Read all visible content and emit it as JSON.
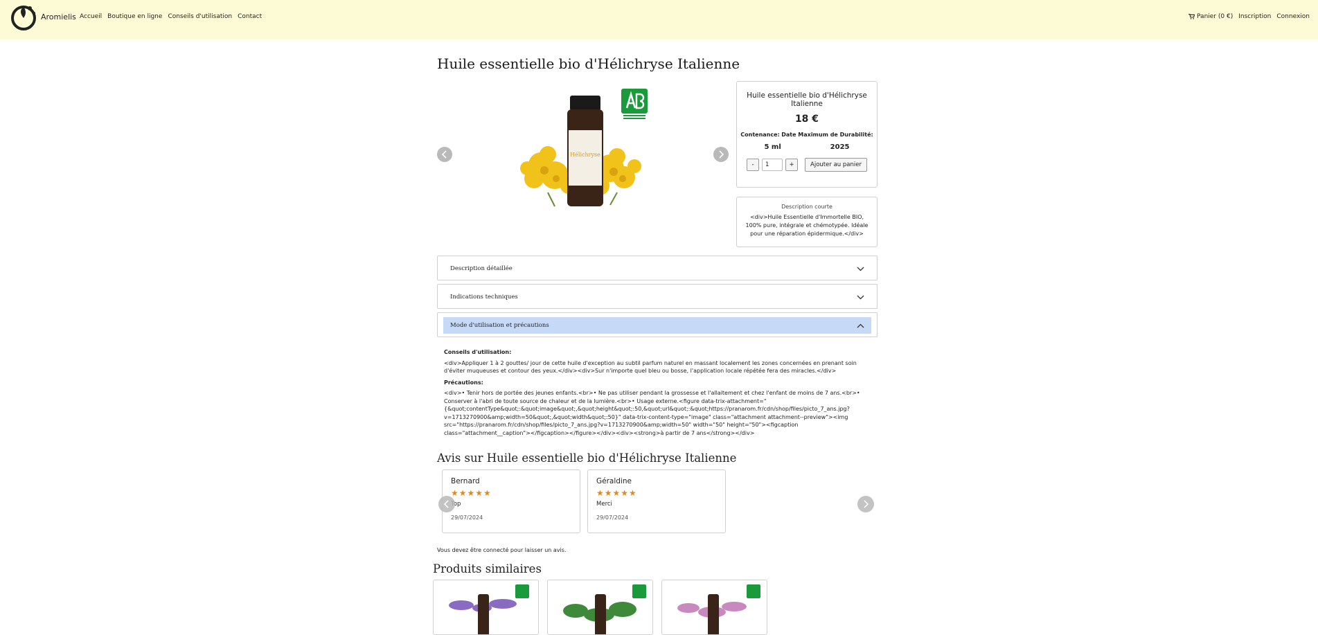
{
  "header": {
    "brand": "Aromielis",
    "nav": [
      "Accueil",
      "Boutique en ligne",
      "Conseils d'utilisation",
      "Contact"
    ],
    "cart": "Panier (0 €)",
    "register": "Inscription",
    "login": "Connexion"
  },
  "product": {
    "title": "Huile essentielle bio d'Hélichryse Italienne",
    "name": "Huile essentielle bio d'Hélichryse Italienne",
    "price": "18 €",
    "contenance_label": "Contenance:",
    "ddm_label": "Date Maximum de Durabilité:",
    "contenance_value": "5 ml",
    "ddm_value": "2025",
    "qty_minus": "-",
    "qty_value": "1",
    "qty_plus": "+",
    "add_to_cart": "Ajouter au panier",
    "short_desc_title": "Description courte",
    "short_desc_text": "<div>Huile Essentielle d'Immortelle BIO, 100% pure, intégrale et chémotypée. Idéale pour une réparation épidermique.</div>",
    "bottle_label_text": "Hélichryse"
  },
  "accordions": [
    {
      "label": "Description détaillée",
      "open": false
    },
    {
      "label": "Indications techniques",
      "open": false
    },
    {
      "label": "Mode d'utilisation et précautions",
      "open": true
    }
  ],
  "usage": {
    "conseils_title": "Conseils d'utilisation:",
    "conseils_text": "<div>Appliquer 1 à 2 gouttes/ jour de cette huile d'exception au subtil parfum naturel en massant localement les zones concernées en prenant soin d'éviter muqueuses et contour des yeux.</div><div>Sur n'importe quel bleu ou bosse, l'application locale répétée fera des miracles.</div>",
    "precautions_title": "Précautions:",
    "precautions_text": "<div>• Tenir hors de portée des jeunes enfants.<br>• Ne pas utiliser pendant la grossesse et l'allaitement et chez l'enfant de moins de 7 ans.<br>• Conserver à l'abri de toute source de chaleur et de la lumière.<br>• Usage externe.<figure data-trix-attachment=\"{&quot;contentType&quot;:&quot;image&quot;,&quot;height&quot;:50,&quot;url&quot;:&quot;https://pranarom.fr/cdn/shop/files/picto_7_ans.jpg?v=1713270900&amp;width=50&quot;,&quot;width&quot;:50}\" data-trix-content-type=\"image\" class=\"attachment attachment--preview\"><img src=\"https://pranarom.fr/cdn/shop/files/picto_7_ans.jpg?v=1713270900&amp;width=50\" width=\"50\" height=\"50\"><figcaption class=\"attachment__caption\"></figcaption></figure></div><div><strong>à partir de 7 ans</strong></div>"
  },
  "reviews": {
    "title": "Avis sur Huile essentielle bio d'Hélichryse Italienne",
    "items": [
      {
        "name": "Bernard",
        "stars": "★★★★★",
        "rating": 5,
        "text": "Top",
        "date": "29/07/2024"
      },
      {
        "name": "Géraldine",
        "stars": "★★★★★",
        "rating": 5,
        "text": "Merci",
        "date": "29/07/2024"
      }
    ],
    "login_notice": "Vous devez être connecté pour laisser un avis."
  },
  "similar": {
    "title": "Produits similaires"
  },
  "colors": {
    "header_bg": "#fdfbd6",
    "accordion_active": "#c6daf7",
    "star": "#e08a1e",
    "ab_green": "#1a9a3a"
  }
}
